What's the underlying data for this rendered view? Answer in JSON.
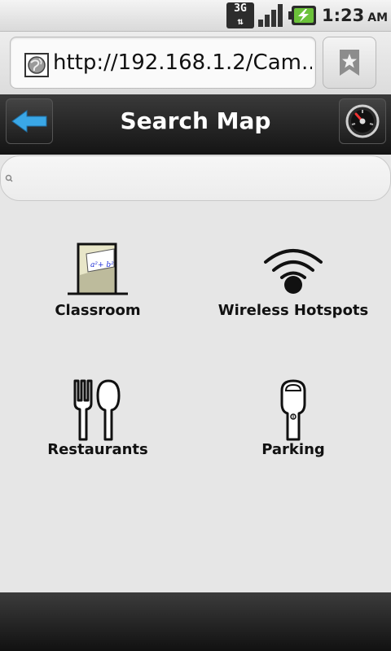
{
  "status_bar": {
    "network": "3G",
    "time": "1:23",
    "ampm": "AM"
  },
  "browser": {
    "url": "http://192.168.1.2/Cam...",
    "bookmark_icon": "bookmark-star-icon"
  },
  "header": {
    "title": "Search Map"
  },
  "search": {
    "placeholder": ""
  },
  "categories": [
    {
      "label": "Classroom",
      "icon": "classroom-icon"
    },
    {
      "label": "Wireless Hotspots",
      "icon": "wifi-icon"
    },
    {
      "label": "Restaurants",
      "icon": "fork-spoon-icon"
    },
    {
      "label": "Parking",
      "icon": "parking-meter-icon"
    }
  ],
  "colors": {
    "title_bar": "#1e1e1e",
    "back_arrow": "#3aa7e6",
    "background": "#e6e6e6"
  }
}
